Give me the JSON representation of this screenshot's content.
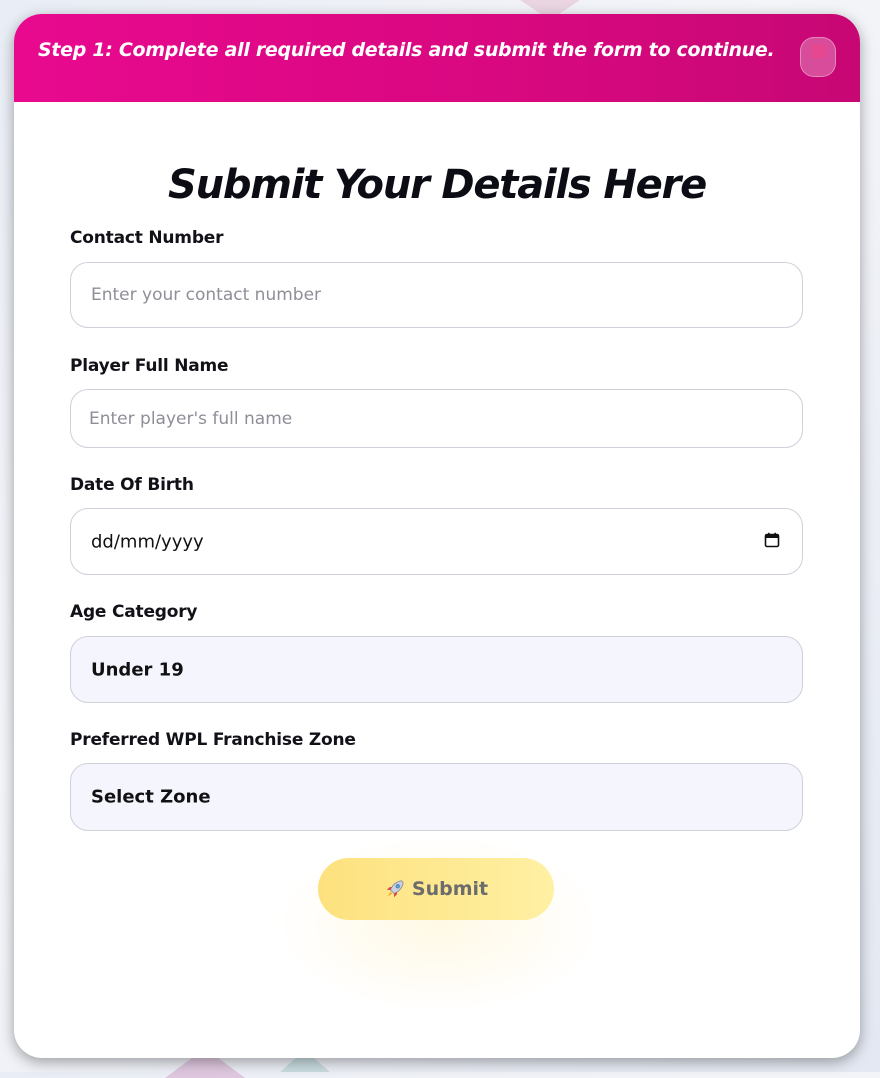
{
  "banner": {
    "text": "Step 1: Complete all required details and submit the form to continue."
  },
  "form": {
    "title": "Submit Your Details Here",
    "fields": {
      "contact": {
        "label": "Contact Number",
        "placeholder": "Enter your contact number",
        "value": ""
      },
      "player_name": {
        "label": "Player Full Name",
        "placeholder": "Enter player's full name",
        "value": ""
      },
      "dob": {
        "label": "Date Of Birth",
        "value": "dd/mm/yyyy"
      },
      "age_category": {
        "label": "Age Category",
        "value": "Under 19"
      },
      "zone": {
        "label": "Preferred WPL Franchise Zone",
        "value": "Select Zone"
      }
    },
    "submit_label": "Submit"
  },
  "icons": {
    "close": "close-icon",
    "calendar": "calendar-icon",
    "rocket": "rocket-icon"
  },
  "colors": {
    "banner": "#e0088a",
    "submit": "#fde17e",
    "select_bg": "#f5f5fd"
  }
}
